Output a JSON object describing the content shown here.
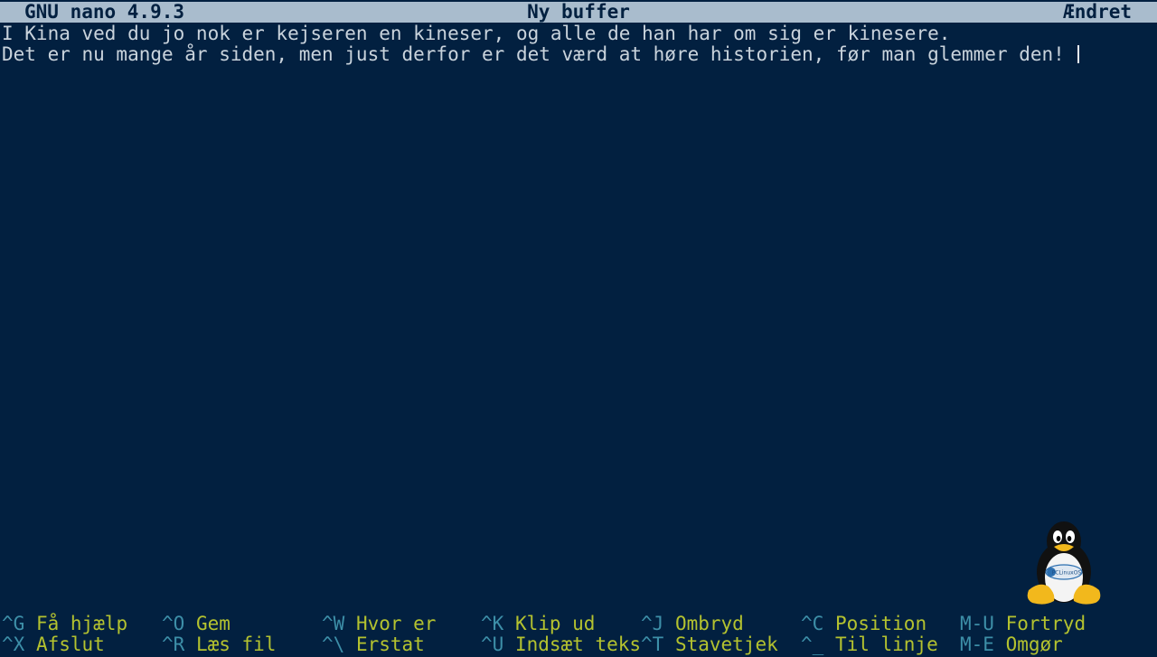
{
  "titlebar": {
    "version": "GNU nano 4.9.3",
    "filename": "Ny buffer",
    "status": "Ændret"
  },
  "buffer": {
    "lines": [
      "I Kina ved du jo nok er kejseren en kineser, og alle de han har om sig er kinesere.",
      "Det er nu mange år siden, men just derfor er det værd at høre historien, før man glemmer den! "
    ]
  },
  "shortcuts": {
    "row1": [
      {
        "key": "^G",
        "label": "Få hjælp"
      },
      {
        "key": "^O",
        "label": "Gem"
      },
      {
        "key": "^W",
        "label": "Hvor er"
      },
      {
        "key": "^K",
        "label": "Klip ud"
      },
      {
        "key": "^J",
        "label": "Ombryd"
      },
      {
        "key": "^C",
        "label": "Position"
      },
      {
        "key": "M-U",
        "label": "Fortryd"
      }
    ],
    "row2": [
      {
        "key": "^X",
        "label": "Afslut"
      },
      {
        "key": "^R",
        "label": "Læs fil"
      },
      {
        "key": "^\\",
        "label": "Erstat"
      },
      {
        "key": "^U",
        "label": "Indsæt teks"
      },
      {
        "key": "^T",
        "label": "Stavetjek"
      },
      {
        "key": "^_",
        "label": "Til linje"
      },
      {
        "key": "M-E",
        "label": "Omgør"
      }
    ]
  },
  "logo": {
    "icon": "tux-penguin-icon",
    "badge_text": "PCLinuxOS"
  },
  "colors": {
    "background": "#022040",
    "titlebar_bg": "#a9bccd",
    "text": "#c9d3dc",
    "shortcut_key": "#3d8fa8",
    "shortcut_label": "#b4c22f"
  }
}
